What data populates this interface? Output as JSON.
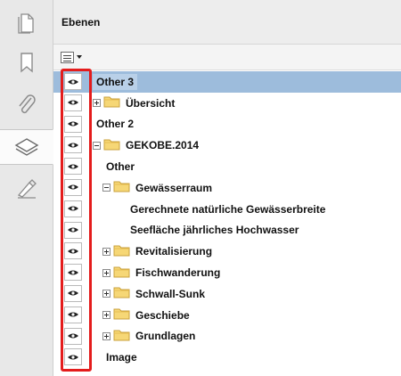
{
  "panel": {
    "title": "Ebenen"
  },
  "rail": {
    "buttons": [
      {
        "name": "pages-icon"
      },
      {
        "name": "bookmark-icon"
      },
      {
        "name": "attachment-icon"
      },
      {
        "name": "layers-icon",
        "active": true
      },
      {
        "name": "signature-icon"
      }
    ]
  },
  "toolbar": {
    "options_icon": "list-options-icon"
  },
  "layers": [
    {
      "label": "Other 3",
      "indent": 0,
      "expander": "none",
      "folder": false,
      "selected": true
    },
    {
      "label": "Übersicht",
      "indent": 0,
      "expander": "plus",
      "folder": true
    },
    {
      "label": "Other 2",
      "indent": 0,
      "expander": "none",
      "folder": false
    },
    {
      "label": "GEKOBE.2014",
      "indent": 0,
      "expander": "minus",
      "folder": true
    },
    {
      "label": "Other",
      "indent": 1,
      "expander": "none",
      "folder": false
    },
    {
      "label": "Gewässerraum",
      "indent": 1,
      "expander": "minus",
      "folder": true
    },
    {
      "label": "Gerechnete natürliche Gewässerbreite",
      "indent": 2,
      "expander": "none",
      "folder": false
    },
    {
      "label": "Seefläche jährliches Hochwasser",
      "indent": 2,
      "expander": "none",
      "folder": false
    },
    {
      "label": "Revitalisierung",
      "indent": 1,
      "expander": "plus",
      "folder": true
    },
    {
      "label": "Fischwanderung",
      "indent": 1,
      "expander": "plus",
      "folder": true
    },
    {
      "label": "Schwall-Sunk",
      "indent": 1,
      "expander": "plus",
      "folder": true
    },
    {
      "label": "Geschiebe",
      "indent": 1,
      "expander": "plus",
      "folder": true
    },
    {
      "label": "Grundlagen",
      "indent": 1,
      "expander": "plus",
      "folder": true
    },
    {
      "label": "Image",
      "indent": 1,
      "expander": "none",
      "folder": false
    }
  ],
  "colors": {
    "highlight": "#e41c1c",
    "selection": "#9dbcdc"
  }
}
